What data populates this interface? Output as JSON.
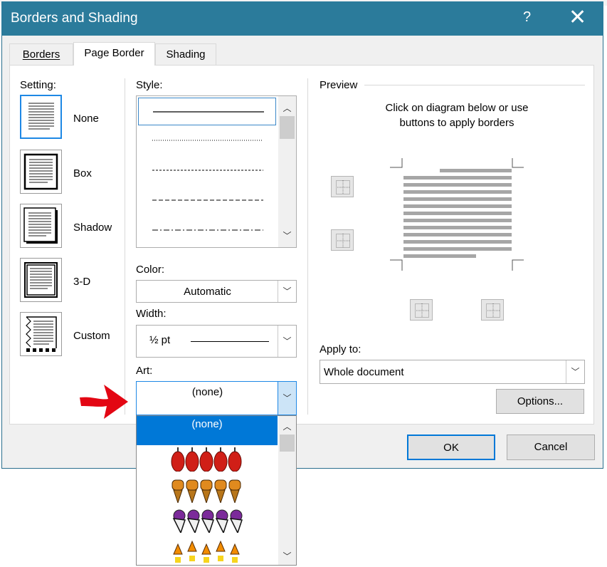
{
  "dialog": {
    "title": "Borders and Shading",
    "help_label": "?",
    "close_label": "✕"
  },
  "tabs": [
    {
      "label": "Borders",
      "active": false
    },
    {
      "label": "Page Border",
      "active": true
    },
    {
      "label": "Shading",
      "active": false
    }
  ],
  "setting": {
    "header": "Setting:",
    "items": [
      {
        "label": "None",
        "selected": true
      },
      {
        "label": "Box",
        "selected": false
      },
      {
        "label": "Shadow",
        "selected": false
      },
      {
        "label": "3-D",
        "selected": false
      },
      {
        "label": "Custom",
        "selected": false
      }
    ]
  },
  "style": {
    "header": "Style:",
    "line_styles": [
      "solid",
      "dotted",
      "dashed-small",
      "dashed",
      "dash-dot"
    ]
  },
  "color": {
    "header": "Color:",
    "value": "Automatic"
  },
  "width": {
    "header": "Width:",
    "value": "½ pt"
  },
  "art": {
    "header": "Art:",
    "value": "(none)",
    "dropdown_selected": "(none)",
    "dropdown_items": [
      "apples-art",
      "ice-cream-cones-art",
      "fruit-art",
      "candy-corn-art"
    ]
  },
  "preview": {
    "header": "Preview",
    "instruction_line1": "Click on diagram below or use",
    "instruction_line2": "buttons to apply borders"
  },
  "apply_to": {
    "header": "Apply to:",
    "value": "Whole document"
  },
  "buttons": {
    "options": "Options...",
    "ok": "OK",
    "cancel": "Cancel"
  },
  "colors": {
    "titlebar": "#2b7b9b",
    "selection": "#0078d7",
    "annotation_arrow": "#e30613"
  }
}
